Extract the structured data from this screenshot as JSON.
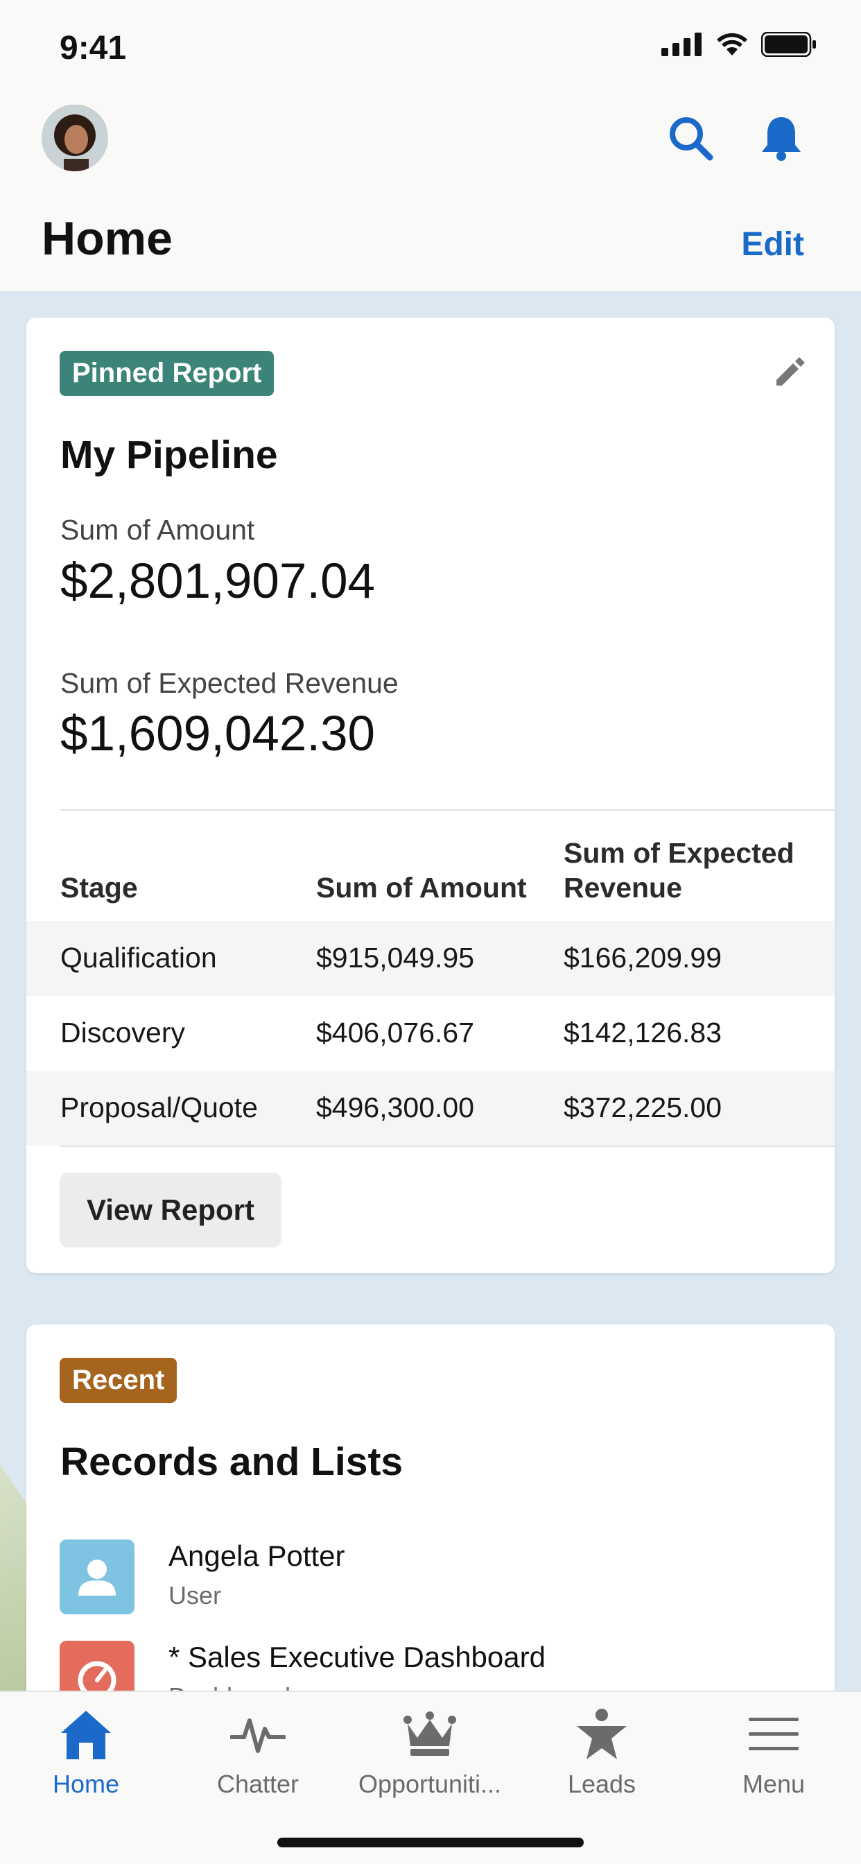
{
  "status_bar": {
    "time": "9:41"
  },
  "header": {
    "title": "Home",
    "edit_label": "Edit"
  },
  "pinned_card": {
    "badge": "Pinned Report",
    "badge_color": "#3c8479",
    "title": "My Pipeline",
    "metrics": [
      {
        "label": "Sum of Amount",
        "value": "$2,801,907.04"
      },
      {
        "label": "Sum of Expected Revenue",
        "value": "$1,609,042.30"
      }
    ],
    "table": {
      "headers": [
        "Stage",
        "Sum of Amount",
        "Sum of Expected Revenue"
      ],
      "header_expected_line1": "Sum of Expected",
      "header_expected_line2": "Revenue",
      "rows": [
        [
          "Qualification",
          "$915,049.95",
          "$166,209.99"
        ],
        [
          "Discovery",
          "$406,076.67",
          "$142,126.83"
        ],
        [
          "Proposal/Quote",
          "$496,300.00",
          "$372,225.00"
        ]
      ]
    },
    "button_label": "View Report"
  },
  "recent_card": {
    "badge": "Recent",
    "badge_color": "#a6651f",
    "title": "Records and Lists",
    "items": [
      {
        "name": "Angela Potter",
        "subtitle": "User",
        "icon": "user-icon",
        "icon_color": "#7ec4e2"
      },
      {
        "name": "* Sales Executive Dashboard",
        "subtitle": "Dashboard",
        "icon": "dashboard-icon",
        "icon_color": "#e46c5d"
      }
    ]
  },
  "tabbar": {
    "tabs": [
      {
        "label": "Home",
        "icon": "home-icon",
        "active": true
      },
      {
        "label": "Chatter",
        "icon": "pulse-icon",
        "active": false
      },
      {
        "label": "Opportuniti...",
        "icon": "crown-icon",
        "active": false
      },
      {
        "label": "Leads",
        "icon": "star-person-icon",
        "active": false
      },
      {
        "label": "Menu",
        "icon": "hamburger-icon",
        "active": false
      }
    ]
  },
  "colors": {
    "accent": "#1b6ac9",
    "page_bg": "#dce8f1"
  }
}
